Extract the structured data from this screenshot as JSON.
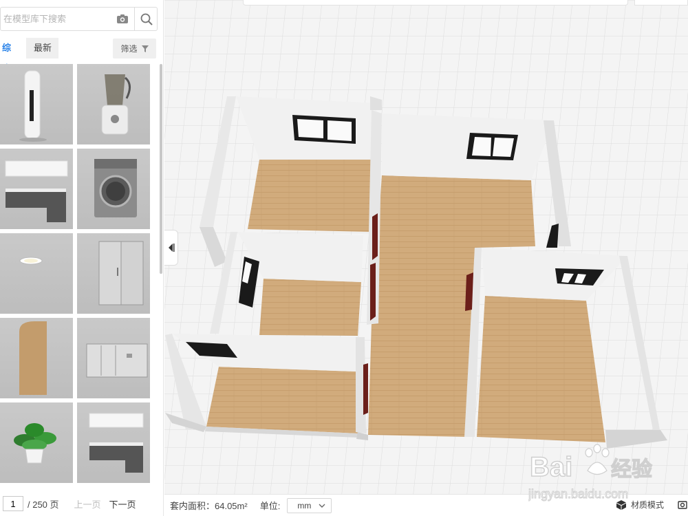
{
  "search": {
    "placeholder": "在模型库下搜索"
  },
  "tabs": [
    {
      "label": "综合"
    },
    {
      "label": "最新"
    }
  ],
  "filter": {
    "label": "筛选"
  },
  "library": {
    "items": [
      {
        "name": "air-conditioner"
      },
      {
        "name": "blender"
      },
      {
        "name": "kitchen-cabinet"
      },
      {
        "name": "washing-machine"
      },
      {
        "name": "ceiling-light"
      },
      {
        "name": "shower-door"
      },
      {
        "name": "wood-panel"
      },
      {
        "name": "wall-panel"
      },
      {
        "name": "potted-plant"
      },
      {
        "name": "kitchen-set"
      }
    ]
  },
  "pager": {
    "current": "1",
    "total": "/ 250 页",
    "prev": "上一页",
    "next": "下一页"
  },
  "status": {
    "area": "套内面积：64.05m²",
    "unit_label": "单位:",
    "unit_value": "mm",
    "mode_label": "材质模式"
  },
  "watermark": {
    "logo": "Bai du 经验",
    "url": "jingyan.baidu.com"
  },
  "colors": {
    "accent": "#2b83e8",
    "floor": "#d1ab7c",
    "wall": "#f2f2f2",
    "door": "#6b1f1a"
  }
}
